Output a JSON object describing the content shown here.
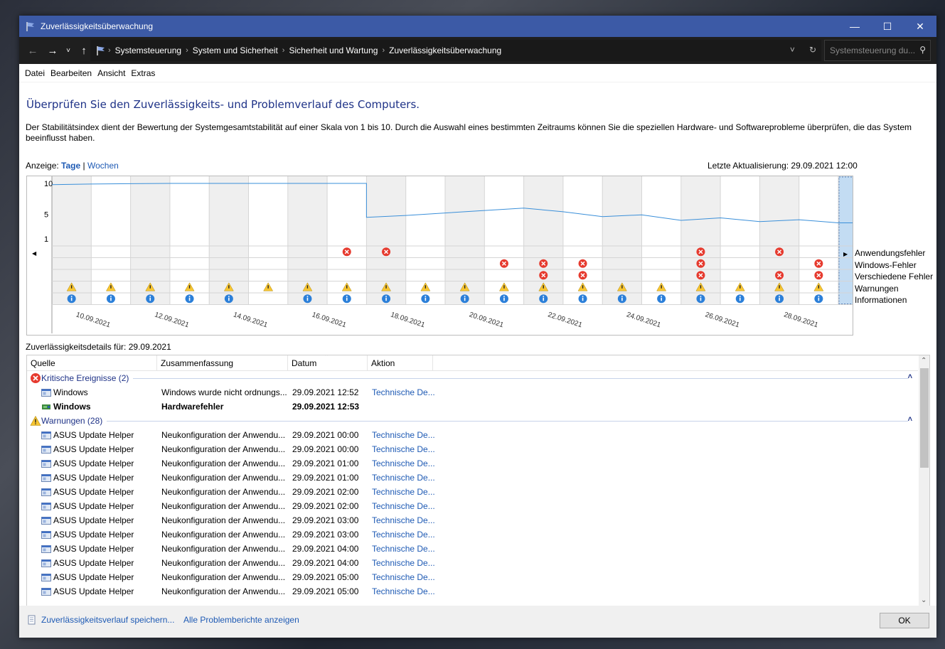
{
  "window": {
    "title": "Zuverlässigkeitsüberwachung"
  },
  "nav": {
    "crumbs": [
      "Systemsteuerung",
      "System und Sicherheit",
      "Sicherheit und Wartung",
      "Zuverlässigkeitsüberwachung"
    ],
    "search_placeholder": "Systemsteuerung du..."
  },
  "menu": [
    "Datei",
    "Bearbeiten",
    "Ansicht",
    "Extras"
  ],
  "heading": "Überprüfen Sie den Zuverlässigkeits- und Problemverlauf des Computers.",
  "description": "Der Stabilitätsindex dient der Bewertung der Systemgesamtstabilität auf einer Skala von 1 bis 10. Durch die Auswahl eines bestimmten Zeitraums können Sie die speziellen Hardware- und Softwareprobleme überprüfen, die das System beeinflusst haben.",
  "view": {
    "label": "Anzeige:",
    "days": "Tage",
    "sep": "|",
    "weeks": "Wochen"
  },
  "last_update": "Letzte Aktualisierung: 29.09.2021 12:00",
  "chart_data": {
    "type": "line",
    "y_ticks": [
      "10",
      "5",
      "1"
    ],
    "ylim": [
      1,
      10
    ],
    "dates": [
      "09.09",
      "10.09",
      "11.09",
      "12.09",
      "13.09",
      "14.09",
      "15.09",
      "16.09",
      "17.09",
      "18.09",
      "19.09",
      "20.09",
      "21.09",
      "22.09",
      "23.09",
      "24.09",
      "25.09",
      "26.09",
      "27.09",
      "28.09",
      "29.09"
    ],
    "x_tick_labels": [
      "10.09.2021",
      "12.09.2021",
      "14.09.2021",
      "16.09.2021",
      "18.09.2021",
      "20.09.2021",
      "22.09.2021",
      "24.09.2021",
      "26.09.2021",
      "28.09.2021"
    ],
    "stability": [
      9.8,
      9.9,
      9.95,
      10,
      10,
      10,
      10,
      10,
      4.5,
      4.8,
      5.2,
      5.6,
      6.0,
      5.4,
      4.6,
      4.9,
      4.0,
      4.4,
      3.8,
      4.1,
      3.6
    ],
    "rows": [
      "Anwendungsfehler",
      "Windows-Fehler",
      "Verschiedene Fehler",
      "Warnungen",
      "Informationen"
    ],
    "events": {
      "Anwendungsfehler": [
        0,
        0,
        0,
        0,
        0,
        0,
        0,
        1,
        1,
        0,
        0,
        0,
        0,
        0,
        0,
        0,
        1,
        0,
        1,
        0,
        0
      ],
      "Windows-Fehler": [
        0,
        0,
        0,
        0,
        0,
        0,
        0,
        0,
        0,
        0,
        0,
        1,
        1,
        1,
        0,
        0,
        1,
        0,
        0,
        1,
        1
      ],
      "Verschiedene Fehler": [
        0,
        0,
        0,
        0,
        0,
        0,
        0,
        0,
        0,
        0,
        0,
        0,
        1,
        1,
        0,
        0,
        1,
        0,
        1,
        1,
        1
      ],
      "Warnungen": [
        1,
        1,
        1,
        1,
        1,
        1,
        1,
        1,
        1,
        1,
        1,
        1,
        1,
        1,
        1,
        1,
        1,
        1,
        1,
        1,
        1
      ],
      "Informationen": [
        1,
        1,
        1,
        1,
        1,
        0,
        1,
        1,
        1,
        1,
        1,
        1,
        1,
        1,
        1,
        1,
        1,
        1,
        1,
        1,
        1
      ]
    },
    "selected_date": "29.09"
  },
  "details": {
    "title": "Zuverlässigkeitsdetails für: 29.09.2021",
    "columns": [
      "Quelle",
      "Zusammenfassung",
      "Datum",
      "Aktion"
    ],
    "groups": [
      {
        "label": "Kritische Ereignisse (2)",
        "rows": [
          {
            "source": "Windows",
            "summary": "Windows wurde nicht ordnungs...",
            "date": "29.09.2021 12:52",
            "action": "Technische De..."
          },
          {
            "source": "Windows",
            "summary": "Hardwarefehler",
            "date": "29.09.2021 12:53",
            "action": ""
          }
        ]
      },
      {
        "label": "Warnungen (28)",
        "rows": [
          {
            "source": "ASUS Update Helper",
            "summary": "Neukonfiguration der Anwendu...",
            "date": "29.09.2021 00:00",
            "action": "Technische De..."
          },
          {
            "source": "ASUS Update Helper",
            "summary": "Neukonfiguration der Anwendu...",
            "date": "29.09.2021 00:00",
            "action": "Technische De..."
          },
          {
            "source": "ASUS Update Helper",
            "summary": "Neukonfiguration der Anwendu...",
            "date": "29.09.2021 01:00",
            "action": "Technische De..."
          },
          {
            "source": "ASUS Update Helper",
            "summary": "Neukonfiguration der Anwendu...",
            "date": "29.09.2021 01:00",
            "action": "Technische De..."
          },
          {
            "source": "ASUS Update Helper",
            "summary": "Neukonfiguration der Anwendu...",
            "date": "29.09.2021 02:00",
            "action": "Technische De..."
          },
          {
            "source": "ASUS Update Helper",
            "summary": "Neukonfiguration der Anwendu...",
            "date": "29.09.2021 02:00",
            "action": "Technische De..."
          },
          {
            "source": "ASUS Update Helper",
            "summary": "Neukonfiguration der Anwendu...",
            "date": "29.09.2021 03:00",
            "action": "Technische De..."
          },
          {
            "source": "ASUS Update Helper",
            "summary": "Neukonfiguration der Anwendu...",
            "date": "29.09.2021 03:00",
            "action": "Technische De..."
          },
          {
            "source": "ASUS Update Helper",
            "summary": "Neukonfiguration der Anwendu...",
            "date": "29.09.2021 04:00",
            "action": "Technische De..."
          },
          {
            "source": "ASUS Update Helper",
            "summary": "Neukonfiguration der Anwendu...",
            "date": "29.09.2021 04:00",
            "action": "Technische De..."
          },
          {
            "source": "ASUS Update Helper",
            "summary": "Neukonfiguration der Anwendu...",
            "date": "29.09.2021 05:00",
            "action": "Technische De..."
          },
          {
            "source": "ASUS Update Helper",
            "summary": "Neukonfiguration der Anwendu...",
            "date": "29.09.2021 05:00",
            "action": "Technische De..."
          }
        ]
      }
    ]
  },
  "footer": {
    "save_link": "Zuverlässigkeitsverlauf speichern...",
    "reports_link": "Alle Problemberichte anzeigen",
    "ok": "OK"
  }
}
